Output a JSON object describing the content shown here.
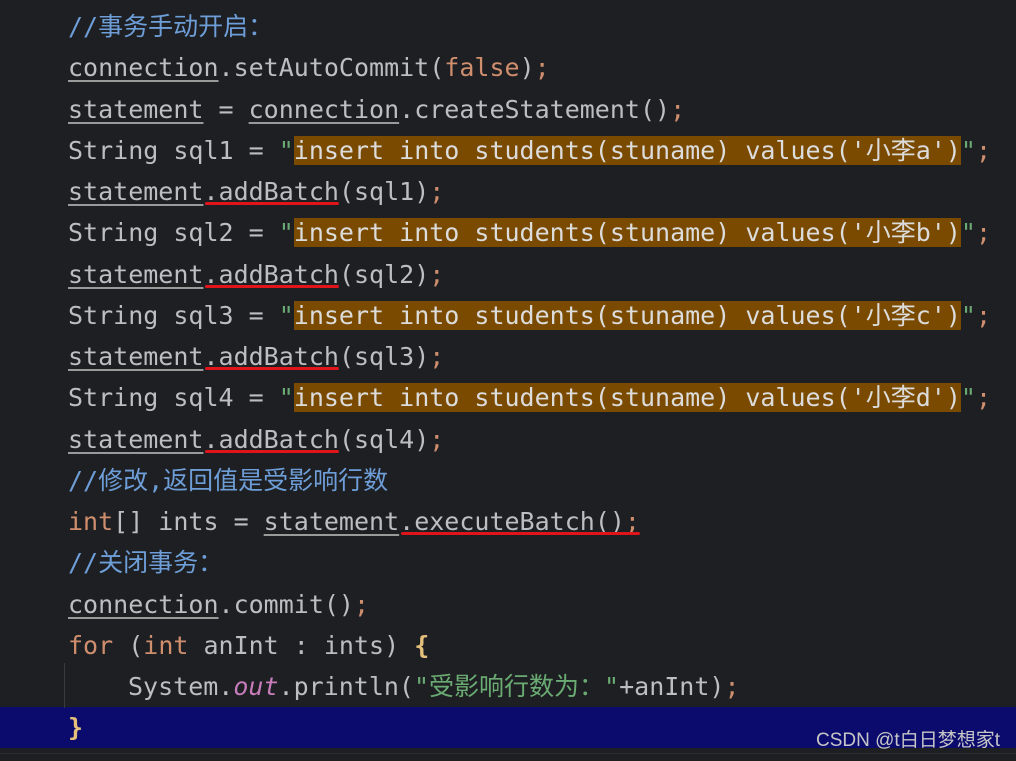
{
  "lines": [
    {
      "kind": "comment",
      "tokens": [
        {
          "t": "//事务手动开启：",
          "c": "comment"
        }
      ]
    },
    {
      "kind": "code",
      "tokens": [
        {
          "t": "connection",
          "c": "var"
        },
        {
          "t": ".setAutoCommit(",
          "c": "plain"
        },
        {
          "t": "false",
          "c": "keyword"
        },
        {
          "t": ")",
          "c": "plain"
        },
        {
          "t": ";",
          "c": "semi"
        }
      ]
    },
    {
      "kind": "code",
      "tokens": [
        {
          "t": "statement",
          "c": "var"
        },
        {
          "t": " = ",
          "c": "plain"
        },
        {
          "t": "connection",
          "c": "var"
        },
        {
          "t": ".createStatement()",
          "c": "plain"
        },
        {
          "t": ";",
          "c": "semi"
        }
      ]
    },
    {
      "kind": "code",
      "tokens": [
        {
          "t": "String sql1 = ",
          "c": "plain"
        },
        {
          "t": "\"",
          "c": "string"
        },
        {
          "t": "insert into students(stuname) values('小李a')",
          "c": "sqlhl"
        },
        {
          "t": "\"",
          "c": "string"
        },
        {
          "t": ";",
          "c": "semi"
        }
      ]
    },
    {
      "kind": "code",
      "tokens": [
        {
          "t": "statement",
          "c": "var"
        },
        {
          "t": ".",
          "c": "plain"
        },
        {
          "t": "addBatch",
          "c": "plain"
        },
        {
          "t": "(sql1)",
          "c": "plain"
        },
        {
          "t": ";",
          "c": "semi"
        }
      ]
    },
    {
      "kind": "code",
      "tokens": [
        {
          "t": "String sql2 = ",
          "c": "plain"
        },
        {
          "t": "\"",
          "c": "string"
        },
        {
          "t": "insert into students(stuname) values('小李b')",
          "c": "sqlhl"
        },
        {
          "t": "\"",
          "c": "string"
        },
        {
          "t": ";",
          "c": "semi"
        }
      ]
    },
    {
      "kind": "code",
      "tokens": [
        {
          "t": "statement",
          "c": "var"
        },
        {
          "t": ".",
          "c": "plain"
        },
        {
          "t": "addBatch",
          "c": "plain"
        },
        {
          "t": "(sql2)",
          "c": "plain"
        },
        {
          "t": ";",
          "c": "semi"
        }
      ]
    },
    {
      "kind": "code",
      "tokens": [
        {
          "t": "String sql3 = ",
          "c": "plain"
        },
        {
          "t": "\"",
          "c": "string"
        },
        {
          "t": "insert into students(stuname) values('小李c')",
          "c": "sqlhl"
        },
        {
          "t": "\"",
          "c": "string"
        },
        {
          "t": ";",
          "c": "semi"
        }
      ]
    },
    {
      "kind": "code",
      "tokens": [
        {
          "t": "statement",
          "c": "var"
        },
        {
          "t": ".",
          "c": "plain"
        },
        {
          "t": "addBatch",
          "c": "plain"
        },
        {
          "t": "(sql3)",
          "c": "plain"
        },
        {
          "t": ";",
          "c": "semi"
        }
      ]
    },
    {
      "kind": "code",
      "tokens": [
        {
          "t": "String sql4 = ",
          "c": "plain"
        },
        {
          "t": "\"",
          "c": "string"
        },
        {
          "t": "insert into students(stuname) values('小李d')",
          "c": "sqlhl"
        },
        {
          "t": "\"",
          "c": "string"
        },
        {
          "t": ";",
          "c": "semi"
        }
      ]
    },
    {
      "kind": "code",
      "tokens": [
        {
          "t": "statement",
          "c": "var"
        },
        {
          "t": ".",
          "c": "plain"
        },
        {
          "t": "addBatch",
          "c": "plain"
        },
        {
          "t": "(sql4)",
          "c": "plain"
        },
        {
          "t": ";",
          "c": "semi"
        }
      ]
    },
    {
      "kind": "comment",
      "tokens": [
        {
          "t": "//修改,返回值是受影响行数",
          "c": "comment"
        }
      ]
    },
    {
      "kind": "code",
      "tokens": [
        {
          "t": "int",
          "c": "keyword"
        },
        {
          "t": "[] ints = ",
          "c": "plain"
        },
        {
          "t": "statement",
          "c": "var"
        },
        {
          "t": ".",
          "c": "plain"
        },
        {
          "t": "executeBatch()",
          "c": "plain"
        },
        {
          "t": ";",
          "c": "semi"
        }
      ]
    },
    {
      "kind": "comment",
      "tokens": [
        {
          "t": "//关闭事务：",
          "c": "comment"
        }
      ]
    },
    {
      "kind": "code",
      "tokens": [
        {
          "t": "connection",
          "c": "var"
        },
        {
          "t": ".commit()",
          "c": "plain"
        },
        {
          "t": ";",
          "c": "semi"
        }
      ]
    },
    {
      "kind": "code",
      "tokens": [
        {
          "t": "for",
          "c": "keyword"
        },
        {
          "t": " (",
          "c": "plain"
        },
        {
          "t": "int",
          "c": "keyword"
        },
        {
          "t": " anInt : ints) ",
          "c": "plain"
        },
        {
          "t": "{",
          "c": "brace"
        }
      ]
    },
    {
      "kind": "code-indent",
      "tokens": [
        {
          "t": "System.",
          "c": "plain"
        },
        {
          "t": "out",
          "c": "field"
        },
        {
          "t": ".println(",
          "c": "plain"
        },
        {
          "t": "\"受影响行数为：\"",
          "c": "string"
        },
        {
          "t": "+anInt)",
          "c": "plain"
        },
        {
          "t": ";",
          "c": "semi"
        }
      ]
    },
    {
      "kind": "current",
      "tokens": [
        {
          "t": "}",
          "c": "brace"
        }
      ]
    }
  ],
  "watermark": "CSDN @t白日梦想家t",
  "colors": {
    "background": "#1e1f22",
    "current_line": "#0b0b6e",
    "sql_highlight": "#7a4a00",
    "comment": "#6e9ed8",
    "keyword": "#cf8e6d",
    "string": "#6aab73",
    "field": "#c77dbb",
    "red_underline": "#e0141b"
  }
}
